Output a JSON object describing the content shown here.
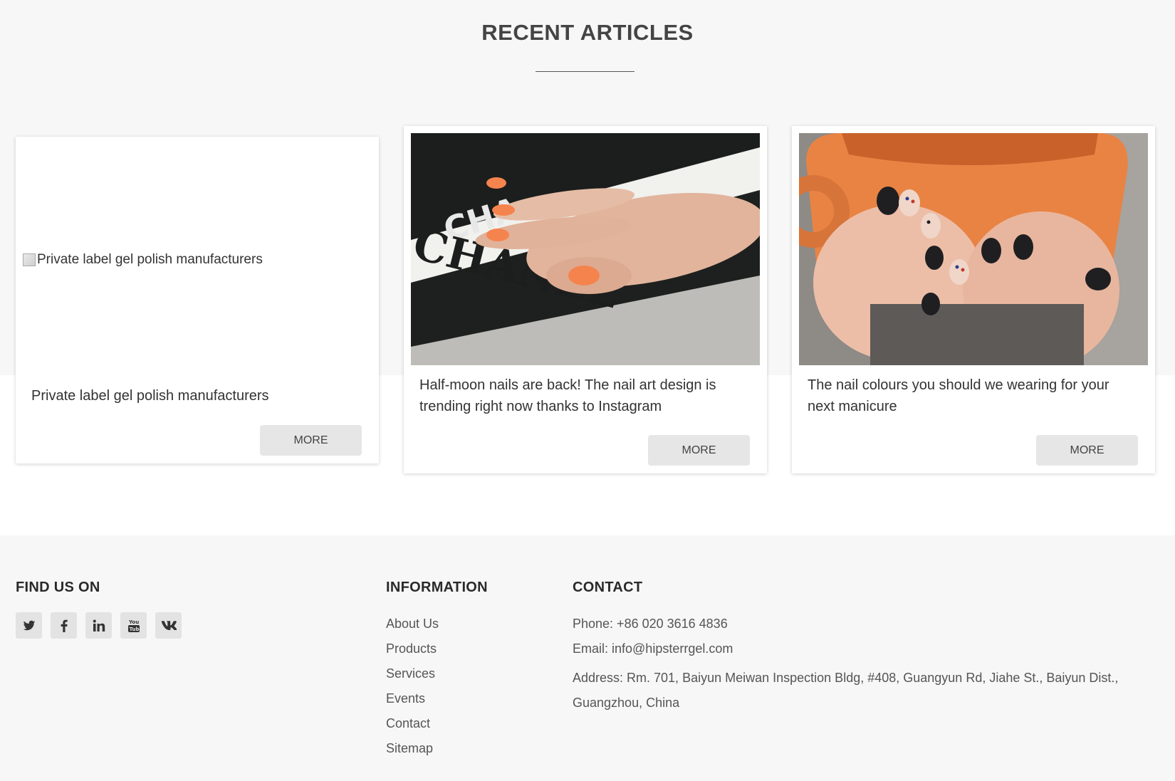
{
  "section": {
    "title": "RECENT ARTICLES"
  },
  "articles": [
    {
      "image_alt": "Private label gel polish manufacturers",
      "title": "Private label gel polish manufacturers",
      "button": "MORE"
    },
    {
      "image_alt": "",
      "title": "Half-moon nails are back! The nail art design is trending right now thanks to Instagram",
      "button": "MORE"
    },
    {
      "image_alt": "",
      "title": "The nail colours you should we wearing for your next manicure",
      "button": "MORE"
    }
  ],
  "footer": {
    "find_us": {
      "title": "FIND US ON",
      "icons": [
        "twitter-icon",
        "facebook-icon",
        "linkedin-icon",
        "youtube-icon",
        "vk-icon"
      ]
    },
    "information": {
      "title": "INFORMATION",
      "links": [
        "About Us",
        "Products",
        "Services",
        "Events",
        "Contact",
        "Sitemap"
      ]
    },
    "contact": {
      "title": "CONTACT",
      "phone": "Phone: +86 020 3616 4836",
      "email": "Email: info@hipsterrgel.com",
      "address": "Address: Rm. 701, Baiyun Meiwan Inspection Bldg, #408, Guangyun Rd, Jiahe St., Baiyun Dist., Guangzhou, China"
    }
  }
}
